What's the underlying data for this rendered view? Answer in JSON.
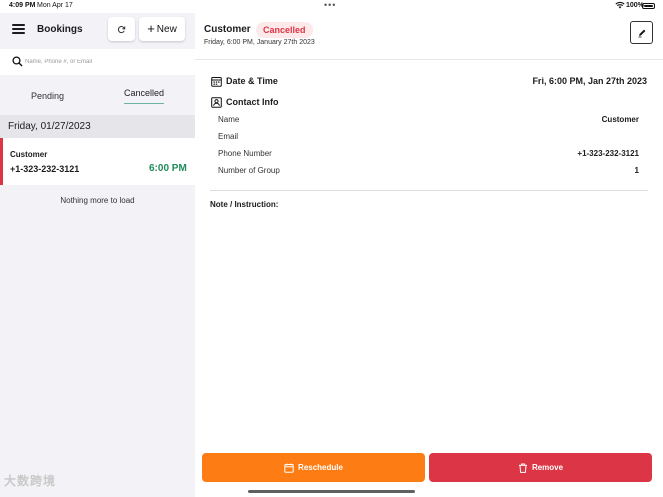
{
  "status_bar": {
    "time": "4:09 PM",
    "date": "Mon Apr 17",
    "battery": "100%"
  },
  "sidebar": {
    "title": "Bookings",
    "new_button": "New",
    "search_placeholder": "Name, Phone #, or Email",
    "tabs": [
      {
        "label": "Pending",
        "active": false
      },
      {
        "label": "Cancelled",
        "active": true
      }
    ],
    "date_header": "Friday, 01/27/2023",
    "bookings": [
      {
        "name": "Customer",
        "phone": "+1-323-232-3121",
        "time": "6:00 PM"
      }
    ],
    "end_message": "Nothing more to load"
  },
  "detail": {
    "customer_name": "Customer",
    "status": "Cancelled",
    "subtitle": "Friday, 6:00 PM, January 27th 2023",
    "date_time_label": "Date & Time",
    "date_time_value": "Fri, 6:00 PM, Jan 27th 2023",
    "contact_label": "Contact Info",
    "fields": {
      "name": {
        "label": "Name",
        "value": "Customer"
      },
      "email": {
        "label": "Email",
        "value": ""
      },
      "phone": {
        "label": "Phone Number",
        "value": "+1-323-232-3121"
      },
      "group": {
        "label": "Number of Group",
        "value": "1"
      }
    },
    "note_label": "Note / Instruction:",
    "reschedule_button": "Reschedule",
    "remove_button": "Remove"
  },
  "colors": {
    "accent_orange": "#fd7c14",
    "danger_red": "#dc3545",
    "success_green": "#1f8a5a",
    "tab_underline": "#6db3a4"
  },
  "watermark": "大数跨境"
}
